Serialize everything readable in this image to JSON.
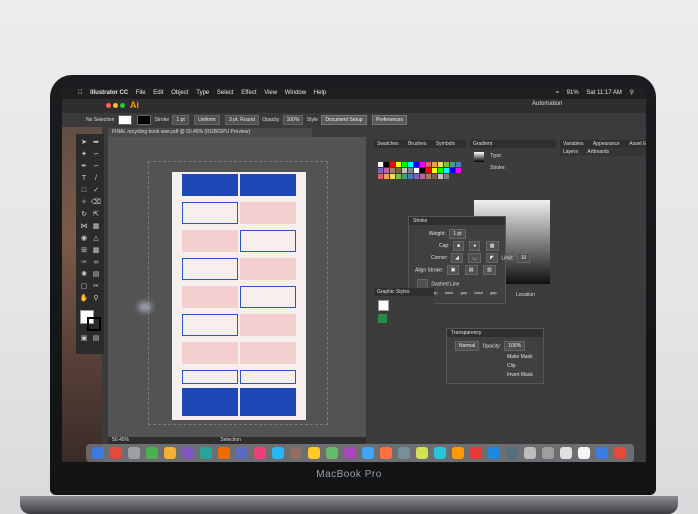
{
  "menubar": {
    "app_name": "Illustrator CC",
    "items": [
      "File",
      "Edit",
      "Object",
      "Type",
      "Select",
      "Effect",
      "View",
      "Window",
      "Help"
    ],
    "battery": "91%",
    "clock": "Sat 11:17 AM"
  },
  "workspace": {
    "label": "Automation"
  },
  "control_bar": {
    "selection": "No Selection",
    "stroke_label": "Stroke",
    "stroke_weight": "1 pt",
    "uniform": "Uniform",
    "brush": "3 pt. Round",
    "opacity_label": "Opacity",
    "opacity_value": "100%",
    "style_label": "Style",
    "doc_setup": "Document Setup",
    "preferences": "Preferences"
  },
  "document": {
    "tab_title": "FINAL recycling book wee.pdf @ 50.45% (RGB/GPU Preview)",
    "zoom": "50.45%",
    "status": "Selection"
  },
  "swatches_panel": {
    "tabs": [
      "Swatches",
      "Brushes",
      "Symbols"
    ]
  },
  "gradient_panel": {
    "title": "Gradient",
    "type_label": "Type:",
    "stroke_label": "Stroke:",
    "location_label": "Location"
  },
  "right_panel": {
    "tabs": [
      "Variables",
      "Appearance",
      "Asset Export"
    ],
    "sub_tabs": [
      "Layers",
      "Artboards"
    ]
  },
  "stroke_panel": {
    "title": "Stroke",
    "weight_label": "Weight:",
    "weight_value": "1 pt",
    "cap_label": "Cap:",
    "corner_label": "Corner:",
    "limit_label": "Limit:",
    "limit_value": "10",
    "align_label": "Align Stroke:",
    "dashed_label": "Dashed Line",
    "dash_fields": [
      "dash",
      "gap",
      "dash",
      "gap",
      "dash",
      "gap"
    ]
  },
  "graphic_styles": {
    "title": "Graphic Styles"
  },
  "transparency_panel": {
    "title": "Transparency",
    "mode": "Normal",
    "opacity_label": "Opacity:",
    "opacity_value": "100%",
    "make_mask": "Make Mask",
    "clip": "Clip",
    "invert_mask": "Invert Mask"
  },
  "laptop_label": "MacBook Pro",
  "colors": {
    "artboard_blue": "#1f47b8",
    "artboard_pink": "#f3cfd0",
    "ui_dark": "#3c3c3c"
  }
}
